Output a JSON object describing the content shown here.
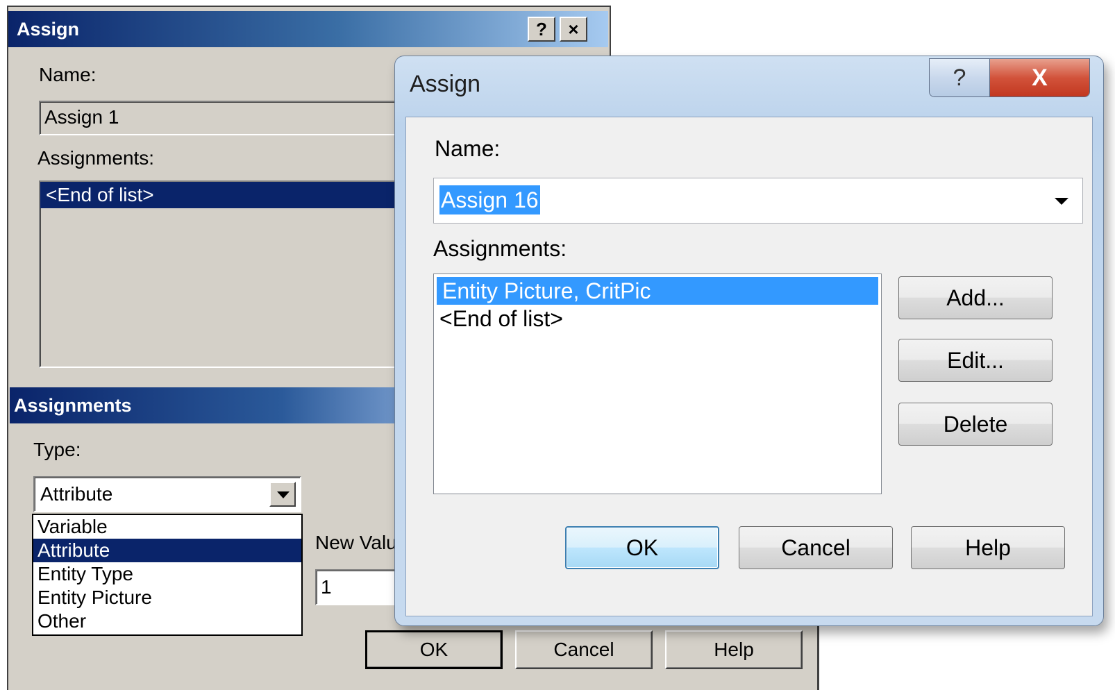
{
  "classic_assign": {
    "title": "Assign",
    "help_glyph": "?",
    "close_glyph": "×",
    "name_label": "Name:",
    "name_value": "Assign 1",
    "assignments_label": "Assignments:",
    "list_items": [
      "<End of list>"
    ]
  },
  "classic_assignments": {
    "title": "Assignments",
    "type_label": "Type:",
    "type_value": "Attribute",
    "type_options": [
      "Variable",
      "Attribute",
      "Entity Type",
      "Entity Picture",
      "Other"
    ],
    "selected_option": "Attribute",
    "new_value_label": "New Valu",
    "new_value": "1",
    "buttons": {
      "ok": "OK",
      "cancel": "Cancel",
      "help": "Help"
    }
  },
  "win7_assign": {
    "title": "Assign",
    "help_glyph": "?",
    "close_glyph": "X",
    "name_label": "Name:",
    "name_value": "Assign 16",
    "assignments_label": "Assignments:",
    "list_items": [
      "Entity Picture, CritPic",
      "<End of list>"
    ],
    "selected_item": "Entity Picture, CritPic",
    "side_buttons": {
      "add": "Add...",
      "edit": "Edit...",
      "delete": "Delete"
    },
    "buttons": {
      "ok": "OK",
      "cancel": "Cancel",
      "help": "Help"
    }
  },
  "colors": {
    "classic_title_start": "#0a246a",
    "classic_face": "#d4d0c8",
    "win7_selection": "#3399ff",
    "win7_close": "#c2371f"
  }
}
